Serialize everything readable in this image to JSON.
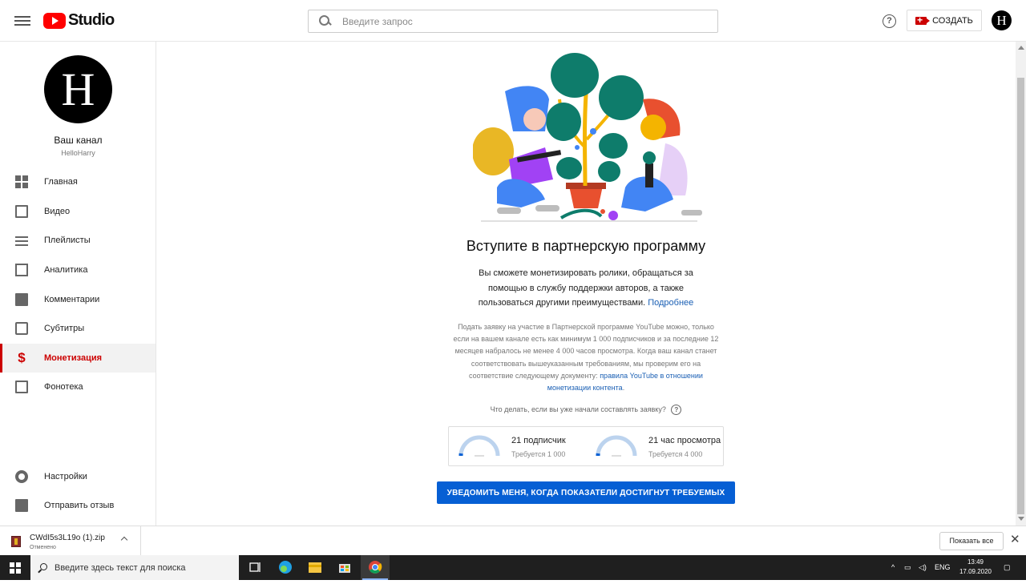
{
  "app": {
    "logo_text": "Studio",
    "search_placeholder": "Введите запрос",
    "create_label": "СОЗДАТЬ",
    "avatar_letter": "H"
  },
  "sidebar": {
    "channel_title": "Ваш канал",
    "channel_handle": "HelloHarry",
    "items": [
      {
        "label": "Главная",
        "icon": "dashboard-icon"
      },
      {
        "label": "Видео",
        "icon": "video-icon"
      },
      {
        "label": "Плейлисты",
        "icon": "playlist-icon"
      },
      {
        "label": "Аналитика",
        "icon": "analytics-icon"
      },
      {
        "label": "Комментарии",
        "icon": "comments-icon"
      },
      {
        "label": "Субтитры",
        "icon": "subtitles-icon"
      },
      {
        "label": "Монетизация",
        "icon": "dollar-icon",
        "active": true
      },
      {
        "label": "Фонотека",
        "icon": "audio-library-icon"
      }
    ],
    "bottom_items": [
      {
        "label": "Настройки",
        "icon": "gear-icon"
      },
      {
        "label": "Отправить отзыв",
        "icon": "feedback-icon"
      }
    ]
  },
  "main": {
    "title": "Вступите в партнерскую программу",
    "description": "Вы сможете монетизировать ролики, обращаться за помощью в службу поддержки авторов, а также пользоваться другими преимуществами.",
    "more_link": "Подробнее",
    "eligibility_text": "Подать заявку на участие в Партнерской программе YouTube можно, только если на вашем канале есть как минимум 1 000 подписчиков и за последние 12 месяцев набралось не менее 4 000 часов просмотра. Когда ваш канал станет соответствовать вышеуказанным требованиям, мы проверим его на соответствие следующему документу:",
    "policy_link": "правила YouTube в отношении монетизации контента",
    "policy_suffix": ".",
    "question": "Что делать, если вы уже начали составлять заявку?",
    "metrics": [
      {
        "value": "21 подписчик",
        "required": "Требуется 1 000",
        "progress": 0.021
      },
      {
        "value": "21 час просмотра",
        "required": "Требуется 4 000",
        "progress": 0.005
      }
    ],
    "notify_button": "УВЕДОМИТЬ МЕНЯ, КОГДА ПОКАЗАТЕЛИ ДОСТИГНУТ ТРЕБУЕМЫХ"
  },
  "downloads": {
    "file_name": "CWdI5s3L19o (1).zip",
    "status": "Отменено",
    "show_all": "Показать все"
  },
  "taskbar": {
    "search_placeholder": "Введите здесь текст для поиска",
    "language": "ENG",
    "time": "13:49",
    "date": "17.09.2020"
  },
  "colors": {
    "accent_red": "#cc0000",
    "button_blue": "#065fd4",
    "link_blue": "#1a5fb4"
  }
}
